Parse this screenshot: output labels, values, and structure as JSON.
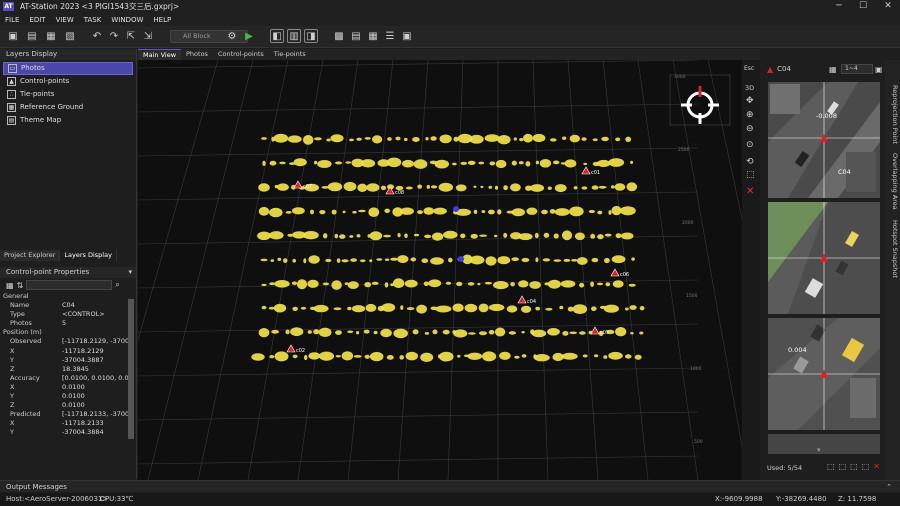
{
  "app": {
    "title": "AT-Station 2023 <3 PIGI1543交三后.gxprj>",
    "logo": "AT"
  },
  "menu": [
    "FILE",
    "EDIT",
    "VIEW",
    "TASK",
    "WINDOW",
    "HELP"
  ],
  "toolbar": {
    "block_select": "All Block"
  },
  "layers_display": {
    "title": "Layers Display",
    "items": [
      {
        "label": "Photos",
        "selected": true
      },
      {
        "label": "Control-points"
      },
      {
        "label": "Tie-points"
      },
      {
        "label": "Reference Ground"
      },
      {
        "label": "Theme Map"
      }
    ]
  },
  "left_tabs": [
    "Project Explorer",
    "Layers Display"
  ],
  "cp_props": {
    "title": "Control-point Properties",
    "rows": [
      {
        "k": "General",
        "v": "",
        "sec": true
      },
      {
        "k": "Name",
        "v": "C04"
      },
      {
        "k": "Type",
        "v": "<CONTROL>"
      },
      {
        "k": "Photos",
        "v": "5"
      },
      {
        "k": "Position (m)",
        "v": "",
        "sec": true
      },
      {
        "k": "Observed",
        "v": "[-11718.2129, -3700"
      },
      {
        "k": "X",
        "v": "-11718.2129"
      },
      {
        "k": "Y",
        "v": "-37004.3887"
      },
      {
        "k": "Z",
        "v": "18.3845"
      },
      {
        "k": "Accuracy",
        "v": "[0.0100, 0.0100, 0.0"
      },
      {
        "k": "X",
        "v": "0.0100"
      },
      {
        "k": "Y",
        "v": "0.0100"
      },
      {
        "k": "Z",
        "v": "0.0100"
      },
      {
        "k": "Predicted",
        "v": "[-11718.2133, -3700"
      },
      {
        "k": "X",
        "v": "-11718.2133"
      },
      {
        "k": "Y",
        "v": "-37004.3884"
      }
    ]
  },
  "view_tabs": [
    "Main View",
    "Photos",
    "Control-points",
    "Tie-points"
  ],
  "viewport": {
    "control_points": [
      {
        "label": "c07"
      },
      {
        "label": "c08"
      },
      {
        "label": "c01"
      },
      {
        "label": "c06"
      },
      {
        "label": "c04"
      },
      {
        "label": "c05"
      },
      {
        "label": "c02"
      }
    ],
    "axis_labels": [
      "3000",
      "2500",
      "2000",
      "1500",
      "1000",
      "500"
    ]
  },
  "view_side": {
    "esc": "Esc",
    "three_d": "3D"
  },
  "reprojection": {
    "point": "C04",
    "page": "1~4",
    "labels": [
      "-0.008",
      "C04",
      "0.004"
    ],
    "used": "Used: 5/54"
  },
  "right_vtabs": [
    "Reprojection Point",
    "Overlapping Area",
    "Hotspot Snapshot"
  ],
  "output": "Output Messages",
  "status": {
    "host": "Host:<AeroServer-2006031>",
    "cpu": "CPU:33℃",
    "x": "X:-9609.9988",
    "y": "Y:-38269.4480",
    "z": "Z: 11.7598"
  },
  "colors": {
    "accent": "#4b47a8",
    "point": "#f2e24a",
    "cp": "#e02020",
    "tie": "#3a3af0"
  }
}
